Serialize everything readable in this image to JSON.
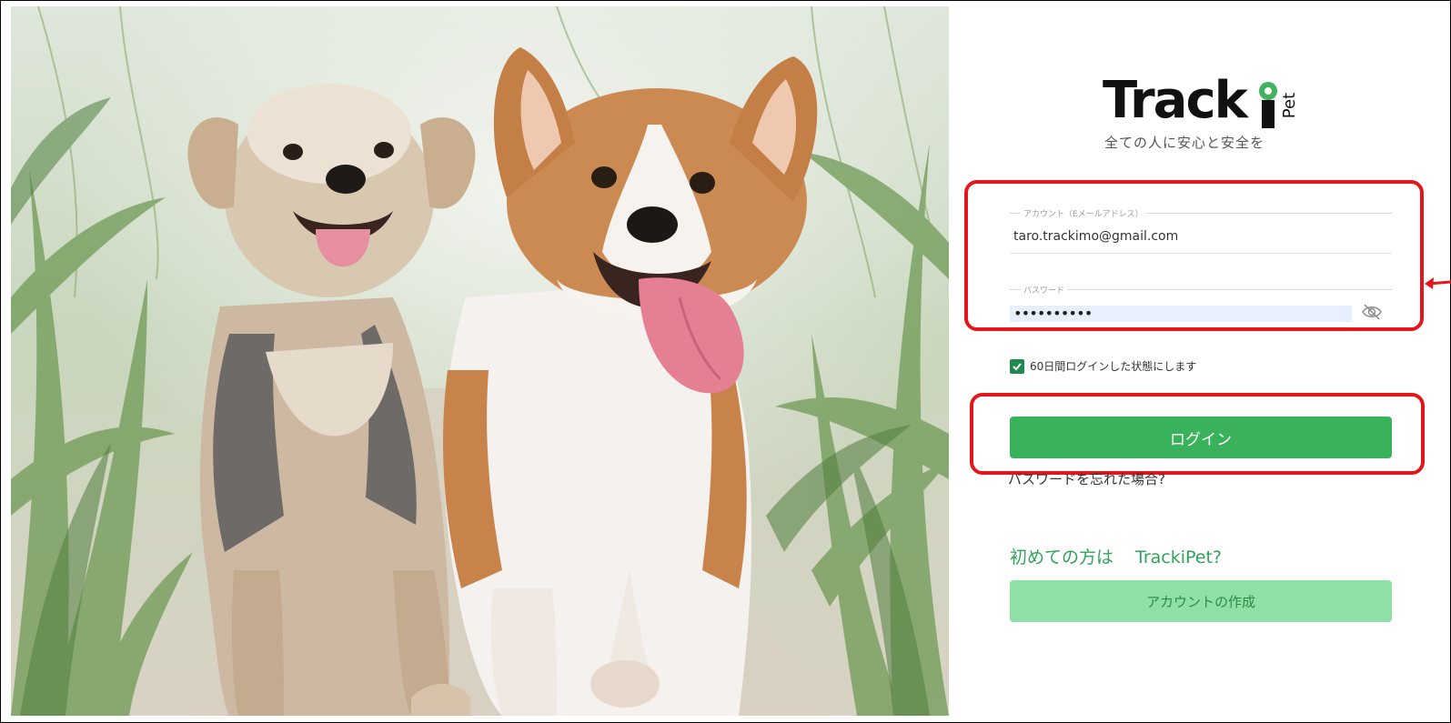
{
  "brand": {
    "logo_text": "Track",
    "logo_suffix": "Pet",
    "tagline": "全ての人に安心と安全を"
  },
  "login": {
    "account_label": "アカウント（Eメールアドレス）",
    "account_value": "taro.trackimo@gmail.com",
    "password_label": "パスワード",
    "password_value": "••••••••••",
    "remember_label": "60日間ログインした状態にします",
    "remember_checked": true,
    "login_button": "ログイン",
    "forgot_link": "パスワードを忘れた場合?"
  },
  "signup": {
    "prompt": "初めての方は",
    "brand_name": "TrackiPet?",
    "create_button": "アカウントの作成"
  },
  "colors": {
    "primary_green": "#39b25b",
    "light_green": "#8ee0a6",
    "highlight_red": "#e4151b"
  },
  "icons": {
    "password_toggle": "eye-slash-icon",
    "logo_pin": "location-pin-icon",
    "remember_check": "checkmark-icon"
  }
}
